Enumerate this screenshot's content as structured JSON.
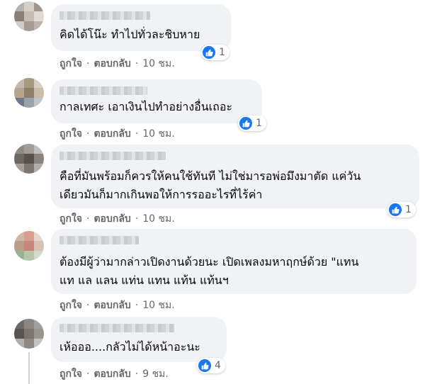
{
  "comments": [
    {
      "text": [
        "คิดได้โน๊ะ ทำไปทั่วละชิบหาย"
      ],
      "reactions": "1",
      "like": "ถูกใจ",
      "reply": "ตอบกลับ",
      "time": "10 ชม."
    },
    {
      "text": [
        "กาลเทศะ เอาเงินไปทำอย่างอื่นเถอะ"
      ],
      "reactions": "1",
      "like": "ถูกใจ",
      "reply": "ตอบกลับ",
      "time": "10 ชม."
    },
    {
      "text": [
        "คือที่มันพร้อมก็ควรให้คนใช้ทันที ไม่ใช่มารอพ่อมึงมาตัด แค่วัน",
        "เดียวมันก็มากเกินพอให้การรออะไรที่ไร้ค่า"
      ],
      "reactions": "1",
      "like": "ถูกใจ",
      "reply": "ตอบกลับ",
      "time": "10 ชม."
    },
    {
      "text": [
        "ต้องมีผู้ว่ามากล่าวเปิดงานด้วยนะ เปิดเพลงมหาฤกษ์ด้วย \"แทน",
        "แท แล แลน แท่น แทน แท้น แท้นฯ"
      ],
      "reactions": "",
      "like": "ถูกใจ",
      "reply": "ตอบกลับ",
      "time": "10 ชม."
    },
    {
      "text": [
        "เห้อออ....กลัวไม่ได้หน้าอะนะ"
      ],
      "reactions": "4",
      "like": "ถูกใจ",
      "reply": "ตอบกลับ",
      "time": "9 ชม."
    }
  ],
  "colors": {
    "bubble": "#f0f2f5",
    "like_blue": "#1877f2",
    "meta_gray": "#65676b"
  }
}
